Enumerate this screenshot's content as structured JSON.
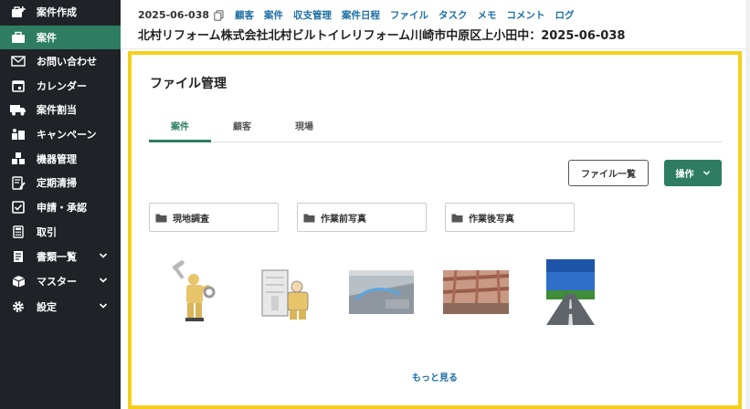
{
  "sidebar": {
    "items": [
      {
        "label": "案件作成",
        "icon": "briefcase-plus-icon"
      },
      {
        "label": "案件",
        "icon": "briefcase-icon",
        "active": true
      },
      {
        "label": "お問い合わせ",
        "icon": "mail-icon"
      },
      {
        "label": "カレンダー",
        "icon": "calendar-icon"
      },
      {
        "label": "案件割当",
        "icon": "truck-icon"
      },
      {
        "label": "キャンペーン",
        "icon": "campaign-icon"
      },
      {
        "label": "機器管理",
        "icon": "equipment-icon"
      },
      {
        "label": "定期清掃",
        "icon": "cleaning-icon"
      },
      {
        "label": "申請・承認",
        "icon": "checkbox-icon"
      },
      {
        "label": "取引",
        "icon": "calculator-icon"
      },
      {
        "label": "書類一覧",
        "icon": "document-icon",
        "expandable": true
      },
      {
        "label": "マスター",
        "icon": "box-icon",
        "expandable": true
      },
      {
        "label": "設定",
        "icon": "gear-icon",
        "expandable": true
      }
    ]
  },
  "header": {
    "case_id": "2025-06-038",
    "nav": [
      "顧客",
      "案件",
      "収支管理",
      "案件日程",
      "ファイル",
      "タスク",
      "メモ",
      "コメント",
      "ログ"
    ],
    "title": "北村リフォーム株式会社北村ビルトイレリフォーム川崎市中原区上小田中：2025-06-038"
  },
  "panel": {
    "title": "ファイル管理",
    "tabs": [
      "案件",
      "顧客",
      "現場"
    ],
    "active_tab": 0,
    "files_button": "ファイル一覧",
    "ops_button": "操作",
    "folders": [
      "現地調査",
      "作業前写真",
      "作業後写真"
    ],
    "more_link": "もっと見る"
  },
  "colors": {
    "sidebar_bg": "#1f2327",
    "accent": "#2e7d63",
    "link": "#1d6fa5",
    "highlight": "#f4cf1a"
  }
}
